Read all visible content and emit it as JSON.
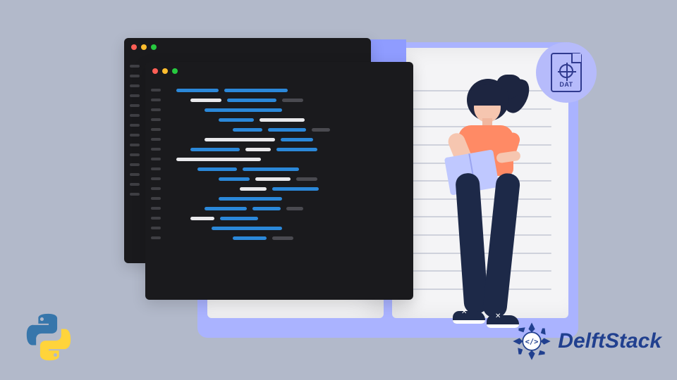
{
  "file_badge": {
    "label": "DAT"
  },
  "brand": {
    "name": "DelftStack"
  },
  "icons": {
    "python": "python-logo-icon",
    "file": "dat-file-icon",
    "gear": "gear-icon",
    "logo_mark": "delftstack-mark-icon"
  },
  "colors": {
    "background": "#b2b9ca",
    "editor_bg": "#1a1a1d",
    "code_blue": "#2b88d9",
    "code_white": "#e9e9ec",
    "accent_lavender": "#aab3ff",
    "shirt": "#ff8a65",
    "pants": "#1d2948",
    "badge_bg": "#b6bbfb",
    "brand_blue": "#21408f"
  }
}
